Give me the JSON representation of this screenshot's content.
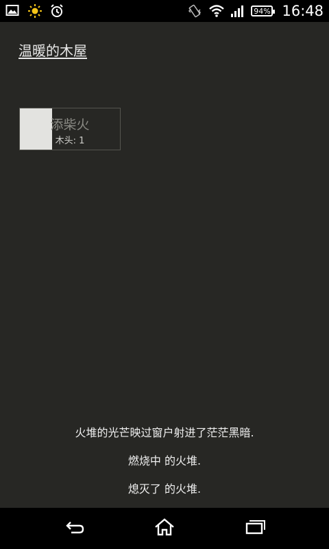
{
  "status_bar": {
    "left_icons": [
      "image-icon",
      "brightness-icon",
      "alarm-icon"
    ],
    "right_icons": [
      "vibrate-icon",
      "wifi-icon",
      "signal-icon"
    ],
    "battery": "94%",
    "time": "16:48"
  },
  "app": {
    "title": "温暖的木屋"
  },
  "action_button": {
    "label": "添柴火",
    "cost": "木头: 1",
    "cooldown_fraction": 0.32
  },
  "log": {
    "lines": [
      "火堆的光芒映过窗户射进了茫茫黑暗.",
      "燃烧中 的火堆.",
      "熄灭了 的火堆."
    ]
  },
  "nav_bar": {
    "buttons": [
      "back-icon",
      "home-icon",
      "recent-apps-icon"
    ]
  },
  "colors": {
    "background": "#272724",
    "bar_background": "#000000",
    "text": "#f0f0f0"
  }
}
